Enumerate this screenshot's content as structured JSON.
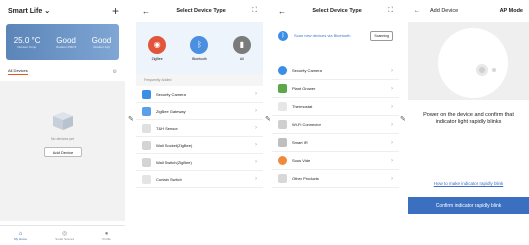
{
  "home": {
    "title": "Smart Life",
    "title_chevron": "⌄",
    "plus": "+",
    "weather": [
      {
        "value": "25.0 °C",
        "label": "Outdoor Temp."
      },
      {
        "value": "Good",
        "label": "Outdoor PM2.5"
      },
      {
        "value": "Good",
        "label": "Outdoor AQI"
      }
    ],
    "tab_all": "All Devices",
    "settings_glyph": "⚙",
    "empty_text": "No devices yet",
    "add_button": "Add Device",
    "nav": [
      {
        "label": "My Home",
        "icon": "⌂"
      },
      {
        "label": "Smart Scenes",
        "icon": "◎"
      },
      {
        "label": "Profile",
        "icon": "●"
      }
    ]
  },
  "select_type": {
    "back": "←",
    "title": "Select Device Type",
    "scan_icon": "⛶",
    "categories": [
      {
        "label": "ZigBee",
        "color": "#e2553a",
        "glyph": "◉"
      },
      {
        "label": "Bluetooth",
        "color": "#4a8fe0",
        "glyph": "ᛒ"
      },
      {
        "label": "All",
        "color": "#7b7b7b",
        "glyph": "▮"
      }
    ],
    "sub_label": "Frequently Added",
    "items": [
      "Security Camera",
      "ZigBee Gateway",
      "T&H Sensor",
      "Wall Socket(ZigBee)",
      "Wall Switch(ZigBee)",
      "Curtain Switch"
    ]
  },
  "scan": {
    "back": "←",
    "title": "Select Device Type",
    "scan_icon": "⛶",
    "bt_glyph": "ᛒ",
    "scan_text": "Scan new devices via Bluetooth",
    "scanning": "Scanning",
    "items": [
      "Security Camera",
      "Plant Grower",
      "Thermostat",
      "Wi-Fi Connector",
      "Smart IR",
      "Sous Vide",
      "Other Products"
    ]
  },
  "add_device": {
    "back": "←",
    "title": "Add Device",
    "mode": "AP Mode",
    "instruction": "Power on the device and confirm that indicator light rapidly blinks",
    "link": "How to make indicator rapidly blink",
    "confirm": "Confirm indicator rapidly blink"
  },
  "pencil": "✎",
  "chevron": "›",
  "colors": {
    "accent": "#3b6fc0",
    "weather_card": "#6a93c6",
    "tab_underline": "#e5561e"
  }
}
